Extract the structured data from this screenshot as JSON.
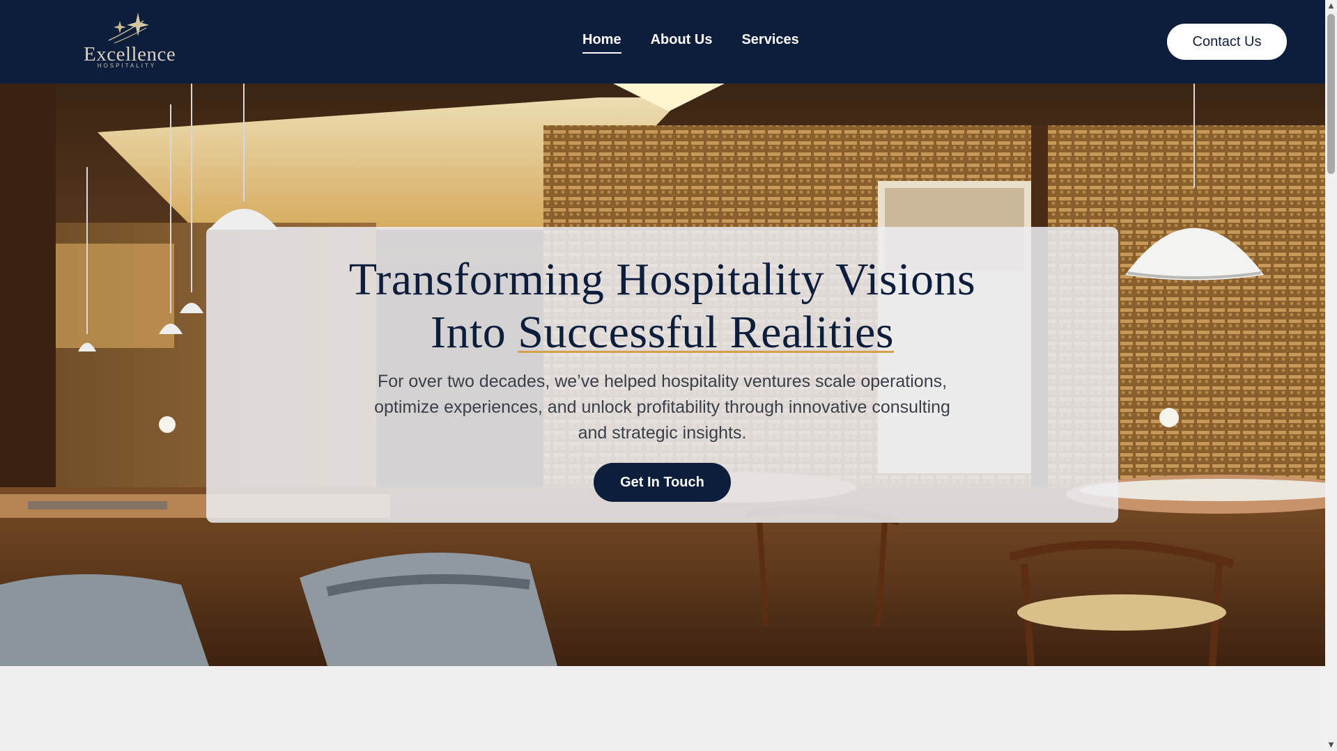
{
  "brand": {
    "name": "Excellence",
    "tagline": "HOSPITALITY",
    "colors": {
      "navy": "#0c1e3b",
      "gold": "#d3a04c",
      "cream": "#d8d0c0"
    }
  },
  "nav": {
    "items": [
      {
        "label": "Home",
        "active": true
      },
      {
        "label": "About Us",
        "active": false
      },
      {
        "label": "Services",
        "active": false
      }
    ],
    "contact_label": "Contact Us"
  },
  "hero": {
    "title_line1": "Transforming Hospitality Visions",
    "title_line2_lead": "Into ",
    "title_line2_highlight": "Successful Realities",
    "description": "For over two decades, we’ve helped hospitality ventures scale operations, optimize experiences, and unlock profitability through innovative consulting and strategic insights.",
    "cta_label": "Get In Touch"
  },
  "scrollbar": {
    "up_icon": "scroll-up-arrow-icon",
    "down_icon": "scroll-down-arrow-icon"
  }
}
